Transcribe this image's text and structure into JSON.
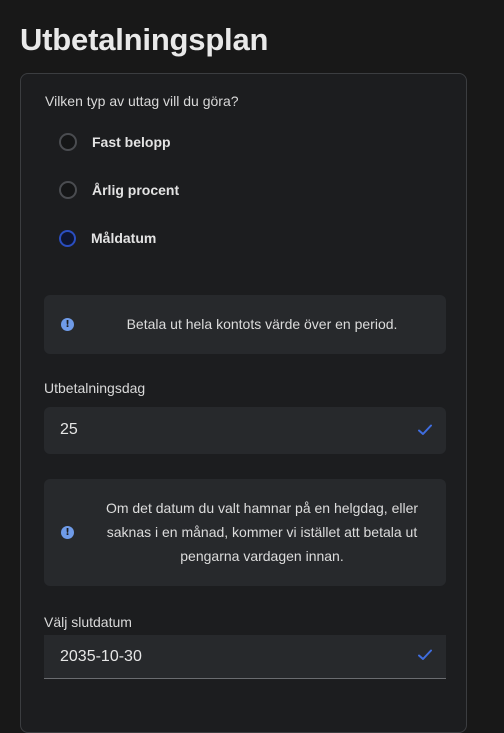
{
  "page": {
    "title": "Utbetalningsplan"
  },
  "withdrawal_type": {
    "question": "Vilken typ av uttag vill du göra?",
    "options": [
      {
        "label": "Fast belopp",
        "selected": false
      },
      {
        "label": "Årlig procent",
        "selected": false
      },
      {
        "label": "Måldatum",
        "selected": true
      }
    ]
  },
  "info_target_date": {
    "icon": "exclamation-circle-icon",
    "text": "Betala ut hela kontots värde över en period."
  },
  "payout_day": {
    "label": "Utbetalningsdag",
    "value": "25",
    "icon": "check-icon"
  },
  "info_payout_day": {
    "icon": "exclamation-circle-icon",
    "text": "Om det datum du valt hamnar på en helgdag, eller saknas i en månad, kommer vi istället att betala ut pengarna vardagen innan."
  },
  "end_date": {
    "label": "Välj slutdatum",
    "value": "2035-10-30",
    "icon": "check-icon"
  },
  "colors": {
    "background": "#181818",
    "card": "#1c1d1f",
    "field": "#27292c",
    "accent": "#2a4ec0",
    "info_icon": "#6f9be8",
    "check": "#3f6ddf"
  }
}
